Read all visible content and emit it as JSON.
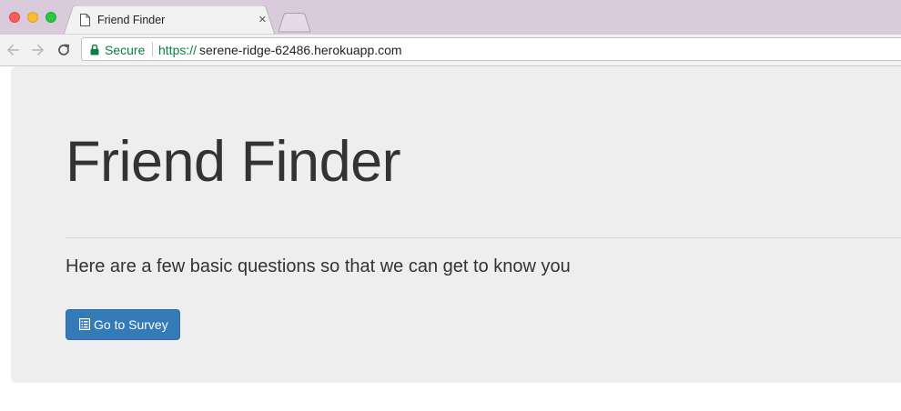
{
  "browser": {
    "tab": {
      "title": "Friend Finder",
      "close": "×",
      "icon": "document-icon"
    },
    "address_bar": {
      "security_label": "Secure",
      "url_protocol": "https://",
      "url_host": "serene-ridge-62486.herokuapp.com"
    }
  },
  "page": {
    "heading": "Friend Finder",
    "lead": "Here are a few basic questions so that we can get to know you",
    "survey_button": {
      "label": "Go to Survey",
      "icon": "list-alt-icon",
      "color": "#337ab7"
    }
  },
  "colors": {
    "titlebar": "#d9cbdc",
    "secure_green": "#0b8043",
    "jumbotron": "#eeeeee"
  }
}
